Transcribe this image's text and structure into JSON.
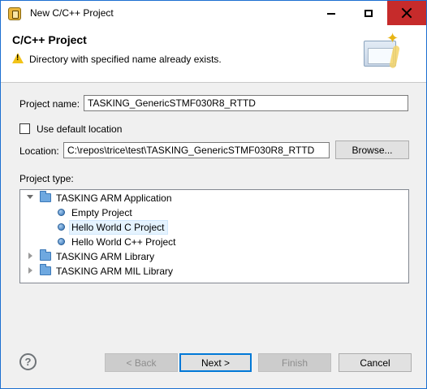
{
  "window": {
    "title": "New C/C++ Project"
  },
  "banner": {
    "title": "C/C++ Project",
    "message": "Directory with specified name already exists."
  },
  "form": {
    "project_name_label": "Project name:",
    "project_name_value": "TASKING_GenericSTMF030R8_RTTD",
    "use_default_location_label": "Use default location",
    "use_default_location_checked": false,
    "location_label": "Location:",
    "location_value": "C:\\repos\\trice\\test\\TASKING_GenericSTMF030R8_RTTD",
    "browse_label": "Browse...",
    "project_type_label": "Project type:"
  },
  "tree": {
    "items": [
      {
        "label": "TASKING ARM Application",
        "expanded": true,
        "children": [
          {
            "label": "Empty Project"
          },
          {
            "label": "Hello World C Project",
            "selected": true
          },
          {
            "label": "Hello World C++ Project"
          }
        ]
      },
      {
        "label": "TASKING ARM Library",
        "expanded": false
      },
      {
        "label": "TASKING ARM MIL Library",
        "expanded": false
      }
    ]
  },
  "footer": {
    "help_glyph": "?",
    "back_label": "< Back",
    "next_label": "Next >",
    "finish_label": "Finish",
    "cancel_label": "Cancel"
  },
  "colors": {
    "accent": "#0078d7",
    "close_button": "#c62b2b",
    "warning": "#f2c318",
    "selection": "#e5f3ff"
  },
  "icons": {
    "app": "project-wizard-icon",
    "warning": "warning-icon",
    "folder": "folder-icon",
    "template": "template-bullet-icon",
    "help": "help-icon"
  }
}
